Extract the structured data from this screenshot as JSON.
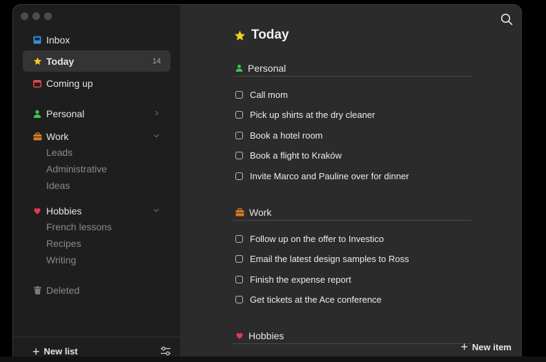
{
  "sidebar": {
    "inbox": "Inbox",
    "today": "Today",
    "today_count": "14",
    "coming_up": "Coming up",
    "lists": [
      {
        "label": "Personal"
      },
      {
        "label": "Work",
        "children": [
          "Leads",
          "Administrative",
          "Ideas"
        ]
      },
      {
        "label": "Hobbies",
        "children": [
          "French lessons",
          "Recipes",
          "Writing"
        ]
      }
    ],
    "deleted": "Deleted",
    "new_list": "New list"
  },
  "main": {
    "title": "Today",
    "sections": [
      {
        "title": "Personal",
        "tasks": [
          "Call mom",
          "Pick up shirts at the dry cleaner",
          "Book a hotel room",
          "Book a flight to Kraków",
          "Invite Marco and Pauline over for dinner"
        ]
      },
      {
        "title": "Work",
        "tasks": [
          "Follow up on the offer to Investico",
          "Email the latest design samples to Ross",
          "Finish the expense report",
          "Get tickets at the Ace conference"
        ]
      },
      {
        "title": "Hobbies",
        "tasks": []
      }
    ],
    "new_item": "New item"
  },
  "colors": {
    "inbox": "#2f8fe0",
    "today_star": "#f5cc1f",
    "coming_up": "#e04848",
    "personal": "#3ec44a",
    "work": "#d97a22",
    "hobbies": "#e5364d"
  }
}
